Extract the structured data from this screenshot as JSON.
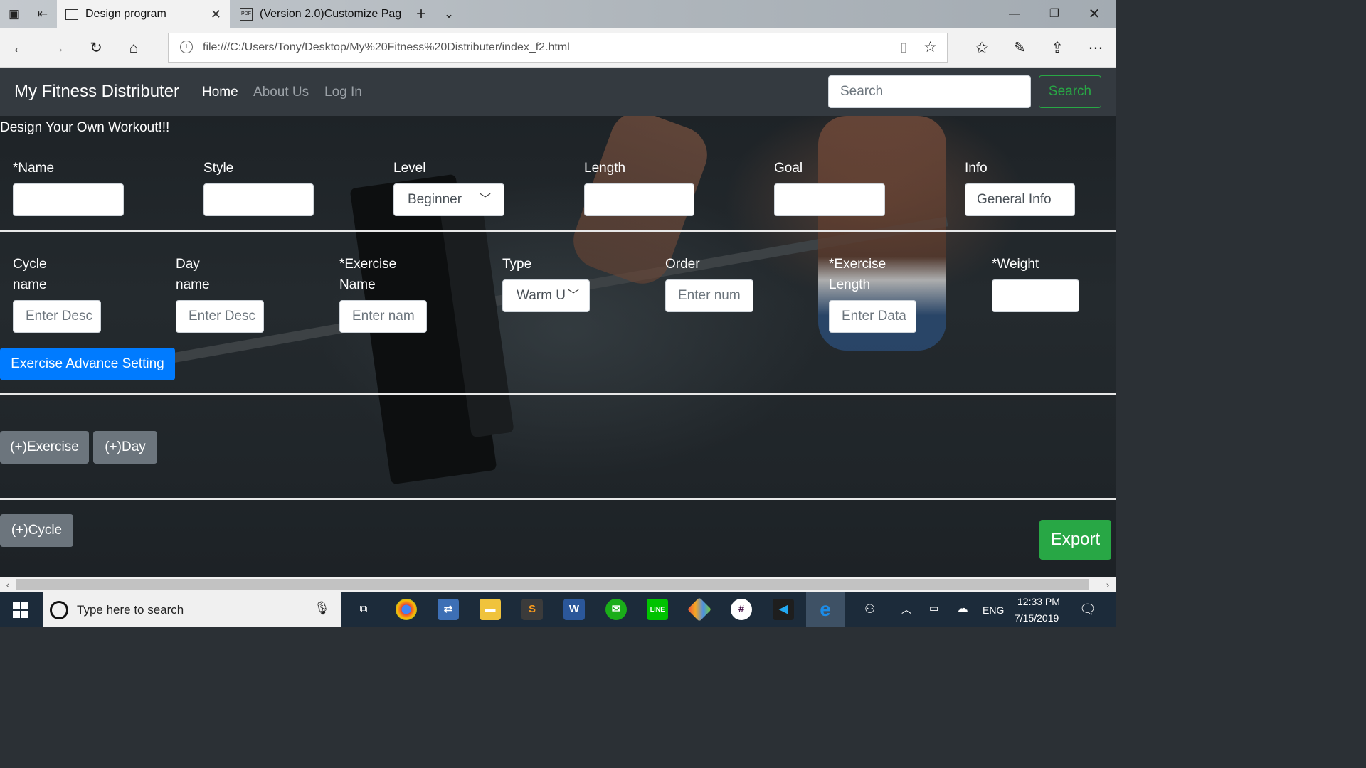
{
  "browser": {
    "tabs": [
      {
        "title": "Design program",
        "active": true
      },
      {
        "title": "(Version 2.0)Customize Pag",
        "active": false
      }
    ],
    "url": "file:///C:/Users/Tony/Desktop/My%20Fitness%20Distributer/index_f2.html"
  },
  "navbar": {
    "brand": "My Fitness Distributer",
    "links": [
      "Home",
      "About Us",
      "Log In"
    ],
    "search_placeholder": "Search",
    "search_button": "Search"
  },
  "page": {
    "heading": "Design Your Own Workout!!!",
    "program_fields": {
      "name_label": "*Name",
      "style_label": "Style",
      "level_label": "Level",
      "level_value": "Beginner",
      "length_label": "Length",
      "goal_label": "Goal",
      "info_label": "Info",
      "info_value": "General Info"
    },
    "exercise_fields": {
      "cycle_label_1": "Cycle",
      "cycle_label_2": "name",
      "cycle_placeholder": "Enter Desc",
      "day_label_1": "Day",
      "day_label_2": "name",
      "day_placeholder": "Enter Desc",
      "exname_label_1": "*Exercise",
      "exname_label_2": "Name",
      "exname_placeholder": "Enter nam",
      "type_label": "Type",
      "type_value": "Warm U",
      "order_label": "Order",
      "order_placeholder": "Enter num",
      "exlen_label_1": "*Exercise",
      "exlen_label_2": "Length",
      "exlen_placeholder": "Enter Data",
      "weight_label": "*Weight"
    },
    "advance_button": "Exercise Advance Setting",
    "add_exercise_button": "(+)Exercise",
    "add_day_button": "(+)Day",
    "add_cycle_button": "(+)Cycle",
    "export_button": "Export"
  },
  "taskbar": {
    "search_text": "Type here to search",
    "language": "ENG",
    "time": "12:33 PM",
    "date": "7/15/2019"
  },
  "colors": {
    "navbar": "#343a40",
    "primary": "#007bff",
    "success": "#28a745",
    "secondary": "#6c757d"
  }
}
